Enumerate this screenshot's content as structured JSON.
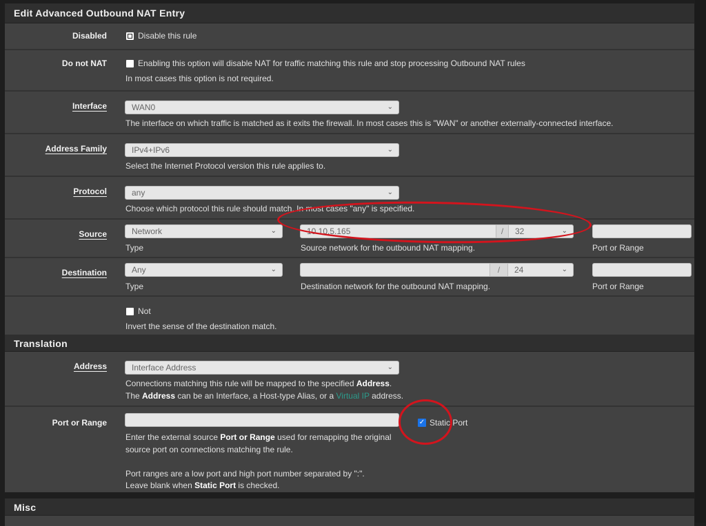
{
  "edit_panel": {
    "title": "Edit Advanced Outbound NAT Entry",
    "disabled": {
      "label": "Disabled",
      "checkbox_label": "Disable this rule",
      "checked": false
    },
    "do_not_nat": {
      "label": "Do not NAT",
      "checkbox_label": "Enabling this option will disable NAT for traffic matching this rule and stop processing Outbound NAT rules",
      "help": "In most cases this option is not required.",
      "checked": false
    },
    "interface": {
      "label": "Interface",
      "value": "WAN0",
      "help": "The interface on which traffic is matched as it exits the firewall. In most cases this is \"WAN\" or another externally-connected interface."
    },
    "address_family": {
      "label": "Address Family",
      "value": "IPv4+IPv6",
      "help": "Select the Internet Protocol version this rule applies to."
    },
    "protocol": {
      "label": "Protocol",
      "value": "any",
      "help": "Choose which protocol this rule should match. In most cases \"any\" is specified."
    },
    "source": {
      "label": "Source",
      "type_value": "Network",
      "type_help": "Type",
      "network_value": "10.10.5.165",
      "slash": "/",
      "mask_value": "32",
      "network_help": "Source network for the outbound NAT mapping.",
      "port_value": "",
      "port_help": "Port or Range"
    },
    "destination": {
      "label": "Destination",
      "type_value": "Any",
      "type_help": "Type",
      "network_value": "",
      "slash": "/",
      "mask_value": "24",
      "network_help": "Destination network for the outbound NAT mapping.",
      "port_value": "",
      "port_help": "Port or Range"
    },
    "not": {
      "checkbox_label": "Not",
      "help": "Invert the sense of the destination match.",
      "checked": false
    }
  },
  "translation_panel": {
    "title": "Translation",
    "address": {
      "label": "Address",
      "value": "Interface Address",
      "help_line1_pre": "Connections matching this rule will be mapped to the specified ",
      "help_line1_bold": "Address",
      "help_line1_post": ".",
      "help_line2_pre": "The ",
      "help_line2_bold": "Address",
      "help_line2_mid": " can be an Interface, a Host-type Alias, or a ",
      "help_line2_link": "Virtual IP",
      "help_line2_post": " address."
    },
    "port_or_range": {
      "label": "Port or Range",
      "value": "",
      "static_port_label": "Static Port",
      "static_port_checked": true,
      "help1_pre": "Enter the external source ",
      "help1_bold": "Port or Range",
      "help1_post": " used for remapping the original",
      "help2": "source port on connections matching the rule.",
      "help3": "Port ranges are a low port and high port number separated by \":\".",
      "help4_pre": "Leave blank when ",
      "help4_bold": "Static Port",
      "help4_post": " is checked."
    }
  },
  "misc_panel": {
    "title": "Misc"
  },
  "colors": {
    "annotation": "#d3141d",
    "link": "#2c9c8c",
    "checkbox_checked": "#1a73e8"
  }
}
